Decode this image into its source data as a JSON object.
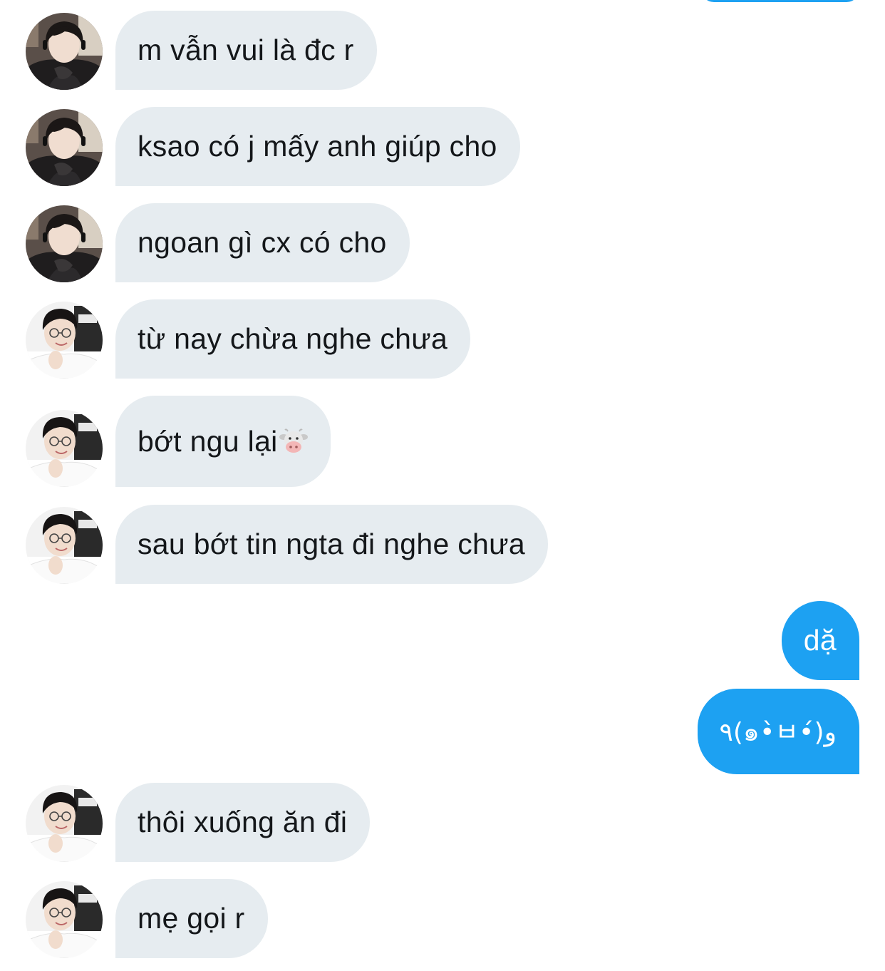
{
  "colors": {
    "incoming_bubble": "#e6ecf0",
    "outgoing_bubble": "#1da1f2",
    "incoming_text": "#14171a",
    "outgoing_text": "#ffffff"
  },
  "messages": [
    {
      "direction": "incoming",
      "avatar": "contact-avatar-a",
      "text": "m vẫn vui là đc r"
    },
    {
      "direction": "incoming",
      "avatar": "contact-avatar-a",
      "text": "ksao có j mấy anh giúp cho"
    },
    {
      "direction": "incoming",
      "avatar": "contact-avatar-a",
      "text": "ngoan gì cx có cho"
    },
    {
      "direction": "incoming",
      "avatar": "contact-avatar-b",
      "text": "từ nay chừa nghe chưa"
    },
    {
      "direction": "incoming",
      "avatar": "contact-avatar-b",
      "text": "bớt ngu lại",
      "emoji": "cow-face-icon"
    },
    {
      "direction": "incoming",
      "avatar": "contact-avatar-b",
      "text": "sau bớt tin ngta đi nghe chưa"
    },
    {
      "direction": "outgoing",
      "text": "dặ"
    },
    {
      "direction": "outgoing",
      "text": "٩(๑•̀ㅂ•́)و"
    },
    {
      "direction": "incoming",
      "avatar": "contact-avatar-b",
      "text": "thôi xuống ăn đi"
    },
    {
      "direction": "incoming",
      "avatar": "contact-avatar-b",
      "text": "mẹ gọi r"
    }
  ]
}
